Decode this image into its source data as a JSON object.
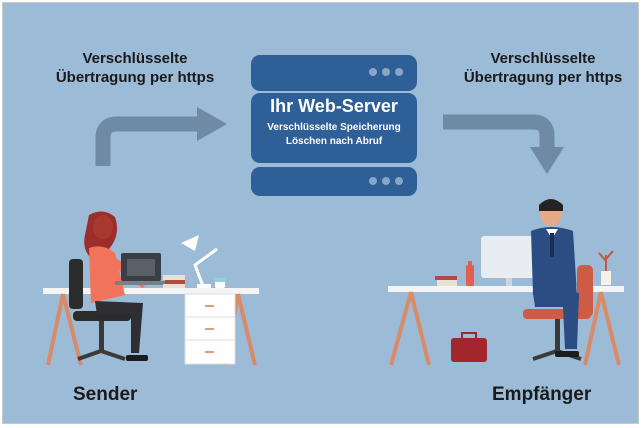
{
  "captions": {
    "left": {
      "line1": "Verschlüsselte",
      "line2": "Übertragung per https"
    },
    "right": {
      "line1": "Verschlüsselte",
      "line2": "Übertragung per https"
    }
  },
  "server": {
    "title": "Ihr Web-Server",
    "line1": "Verschlüsselte Speicherung",
    "line2": "Löschen nach Abruf"
  },
  "roles": {
    "sender": "Sender",
    "receiver": "Empfänger"
  },
  "colors": {
    "background": "#9bbbd7",
    "server": "#2e5f97",
    "arrow": "#6f8aa5",
    "desk_legs": "#d98a67"
  }
}
